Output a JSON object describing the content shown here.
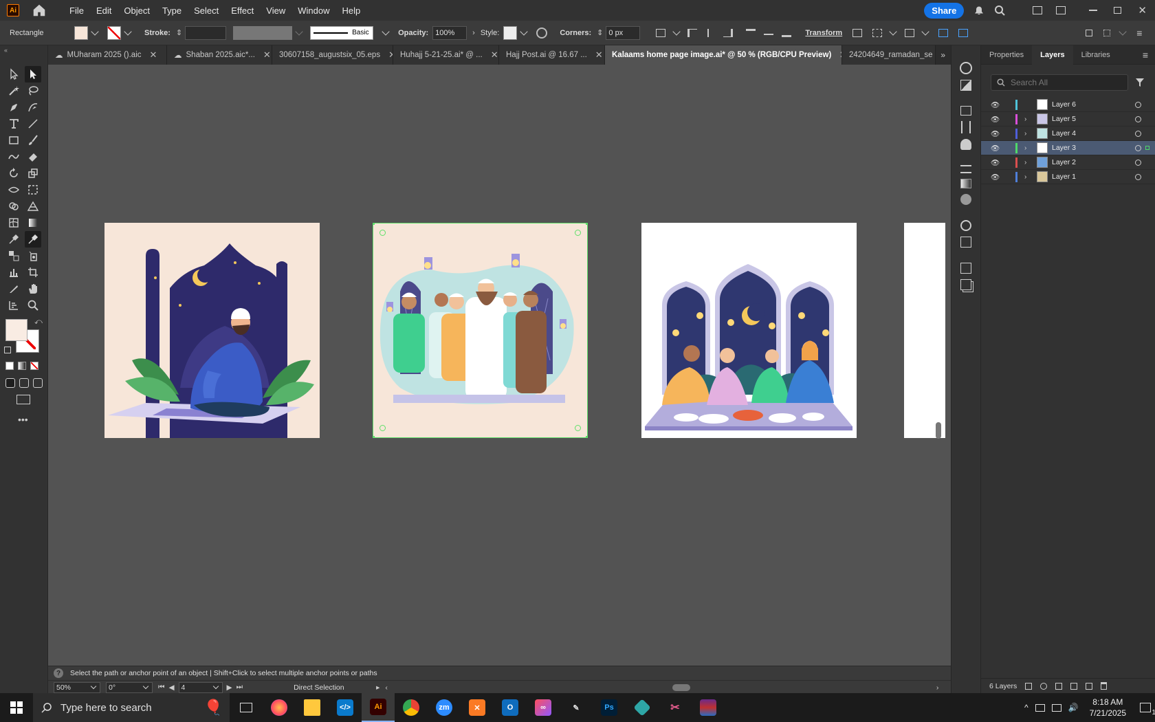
{
  "menubar": {
    "app_icon": "Ai",
    "items": [
      "File",
      "Edit",
      "Object",
      "Type",
      "Select",
      "Effect",
      "View",
      "Window",
      "Help"
    ],
    "share_label": "Share"
  },
  "control": {
    "object_type": "Rectangle",
    "stroke_label": "Stroke:",
    "brush_label": "Basic",
    "opacity_label": "Opacity:",
    "opacity_value": "100%",
    "style_label": "Style:",
    "corners_label": "Corners:",
    "corners_value": "0 px",
    "transform_label": "Transform"
  },
  "tabs": [
    {
      "label": "MUharam 2025 ().aic"
    },
    {
      "label": "Shaban 2025.aic*..."
    },
    {
      "label": "30607158_augustsix_05.eps"
    },
    {
      "label": "Huhajj 5-21-25.ai* @ ..."
    },
    {
      "label": "Hajj Post.ai @ 16.67 ..."
    },
    {
      "label": "Kalaams home page image.ai* @ 50 % (RGB/CPU Preview)"
    },
    {
      "label": "24204649_ramadan_se"
    }
  ],
  "status": {
    "hint": "Select the path or anchor point of an object  |  Shift+Click to select multiple anchor points or paths",
    "zoom": "50%",
    "rotation": "0°",
    "artboard": "4",
    "tool": "Direct Selection"
  },
  "panel": {
    "tabs": [
      "Properties",
      "Layers",
      "Libraries"
    ],
    "search_placeholder": "Search All",
    "layers": [
      {
        "name": "Layer 6",
        "color": "#4fc3d9"
      },
      {
        "name": "Layer 5",
        "color": "#d94fd9"
      },
      {
        "name": "Layer 4",
        "color": "#4f5fd9"
      },
      {
        "name": "Layer 3",
        "color": "#4fd96a"
      },
      {
        "name": "Layer 2",
        "color": "#d94f4f"
      },
      {
        "name": "Layer 1",
        "color": "#4f7fd9"
      }
    ],
    "footer_count": "6 Layers"
  },
  "taskbar": {
    "search_placeholder": "Type here to search",
    "time": "8:18 AM",
    "date": "7/21/2025",
    "notification_count": "1"
  }
}
